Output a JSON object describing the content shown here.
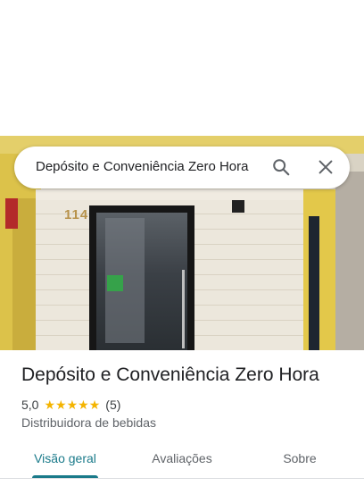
{
  "search": {
    "query": "Depósito e Conveniência Zero Hora"
  },
  "photo": {
    "house_number": "114"
  },
  "place": {
    "title": "Depósito e Conveniência Zero Hora",
    "rating": "5,0",
    "stars": 5,
    "review_count": "(5)",
    "category": "Distribuidora de bebidas"
  },
  "tabs": [
    {
      "label": "Visão geral",
      "active": true
    },
    {
      "label": "Avaliações",
      "active": false
    },
    {
      "label": "Sobre",
      "active": false
    }
  ],
  "colors": {
    "accent": "#1a7a8a",
    "star": "#f4b400"
  }
}
